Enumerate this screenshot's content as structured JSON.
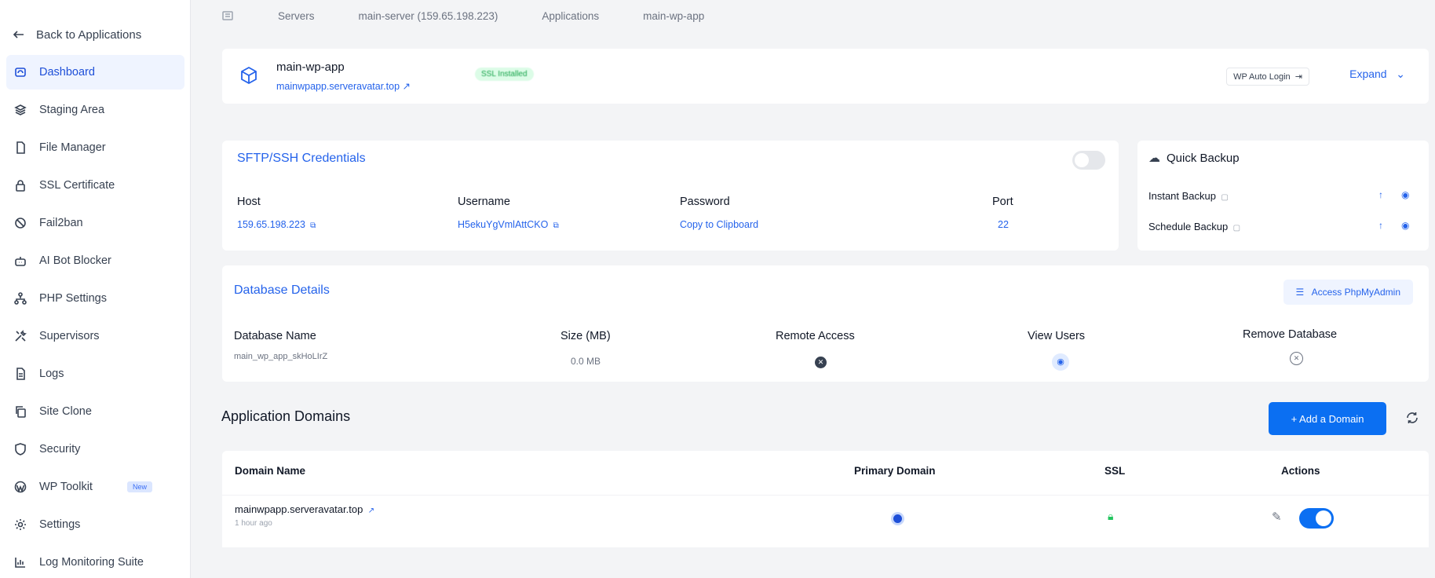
{
  "sidebar": {
    "back_label": "Back to Applications",
    "items": [
      {
        "label": "Dashboard",
        "icon": "dashboard-icon"
      },
      {
        "label": "Staging Area",
        "icon": "layers-icon"
      },
      {
        "label": "File Manager",
        "icon": "file-icon"
      },
      {
        "label": "SSL Certificate",
        "icon": "lock-icon"
      },
      {
        "label": "Fail2ban",
        "icon": "ban-icon"
      },
      {
        "label": "AI Bot Blocker",
        "icon": "robot-icon"
      },
      {
        "label": "PHP Settings",
        "icon": "sitemap-icon"
      },
      {
        "label": "Supervisors",
        "icon": "tools-icon"
      },
      {
        "label": "Logs",
        "icon": "log-icon"
      },
      {
        "label": "Site Clone",
        "icon": "copy-icon"
      },
      {
        "label": "Security",
        "icon": "shield-icon"
      },
      {
        "label": "WP Toolkit",
        "icon": "wordpress-icon",
        "badge": "New"
      },
      {
        "label": "Settings",
        "icon": "gear-icon"
      },
      {
        "label": "Log Monitoring Suite",
        "icon": "chart-icon"
      }
    ],
    "active_index": 0
  },
  "breadcrumb": {
    "items": [
      "Servers",
      "main-server (159.65.198.223)",
      "Applications",
      "main-wp-app"
    ]
  },
  "app": {
    "name": "main-wp-app",
    "url": "mainwpapp.serveravatar.top ↗",
    "ssl_badge": "SSL Installed",
    "wp_login": "WP Auto Login",
    "expand": "Expand"
  },
  "sftp": {
    "title": "SFTP/SSH Credentials",
    "host_label": "Host",
    "host_value": "159.65.198.223",
    "username_label": "Username",
    "username_value": "H5ekuYgVmlAttCKO",
    "password_label": "Password",
    "password_value": "Copy to Clipboard",
    "port_label": "Port",
    "port_value": "22"
  },
  "quick_backup": {
    "title": "Quick Backup",
    "instant": "Instant Backup",
    "schedule": "Schedule Backup"
  },
  "database": {
    "title": "Database Details",
    "access_button": "Access PhpMyAdmin",
    "headers": {
      "name": "Database Name",
      "size": "Size (MB)",
      "remote": "Remote Access",
      "users": "View Users",
      "remove": "Remove Database"
    },
    "row": {
      "name": "main_wp_app_skHoLIrZ",
      "size": "0.0 MB"
    }
  },
  "domains": {
    "title": "Application Domains",
    "add_button": "+ Add a Domain",
    "headers": {
      "name": "Domain Name",
      "primary": "Primary Domain",
      "ssl": "SSL",
      "actions": "Actions"
    },
    "row": {
      "domain": "mainwpapp.serveravatar.top",
      "age": "1 hour ago"
    }
  },
  "colors": {
    "accent": "#2563eb",
    "primary_button": "#0b6ff2"
  }
}
